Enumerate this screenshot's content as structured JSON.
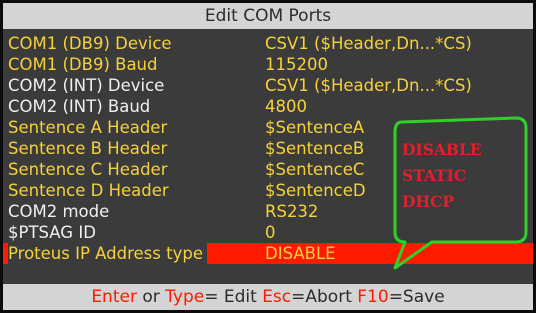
{
  "title": "Edit COM Ports",
  "rows": [
    {
      "label": "COM1 (DB9) Device",
      "value": "CSV1 ($Header,Dn...*CS)",
      "tone": "yellow"
    },
    {
      "label": "COM1 (DB9) Baud",
      "value": "115200",
      "tone": "yellow"
    },
    {
      "label": "COM2 (INT) Device",
      "value": "CSV1 ($Header,Dn...*CS)",
      "tone": "white"
    },
    {
      "label": "COM2 (INT) Baud",
      "value": "4800",
      "tone": "white"
    },
    {
      "label": "Sentence A Header",
      "value": "$SentenceA",
      "tone": "yellow"
    },
    {
      "label": "Sentence B Header",
      "value": "$SentenceB",
      "tone": "yellow"
    },
    {
      "label": "Sentence C Header",
      "value": "$SentenceC",
      "tone": "yellow"
    },
    {
      "label": "Sentence D Header",
      "value": "$SentenceD",
      "tone": "yellow"
    },
    {
      "label": "COM2 mode",
      "value": "RS232",
      "tone": "white"
    },
    {
      "label": "$PTSAG ID",
      "value": "0",
      "tone": "white"
    },
    {
      "label": "Proteus IP Address type",
      "value": "DISABLE",
      "tone": "selected"
    }
  ],
  "statusbar": {
    "enter_key": "Enter",
    "or_text": " or ",
    "type_key": "Type",
    "edit_text": "= Edit ",
    "esc_key": "Esc",
    "abort_text": "=Abort ",
    "f10_key": "F10",
    "save_text": "=Save"
  },
  "callout": {
    "options": [
      "DISABLE",
      "STATIC",
      "DHCP"
    ],
    "border_color": "#2fd02a",
    "text_color": "#e0202a"
  },
  "colors": {
    "background": "#3b3b3b",
    "bars": "#d4d4d4",
    "yellow_text": "#f5d23a",
    "white_text": "#f0f0f0",
    "highlight": "#ff1b00"
  }
}
